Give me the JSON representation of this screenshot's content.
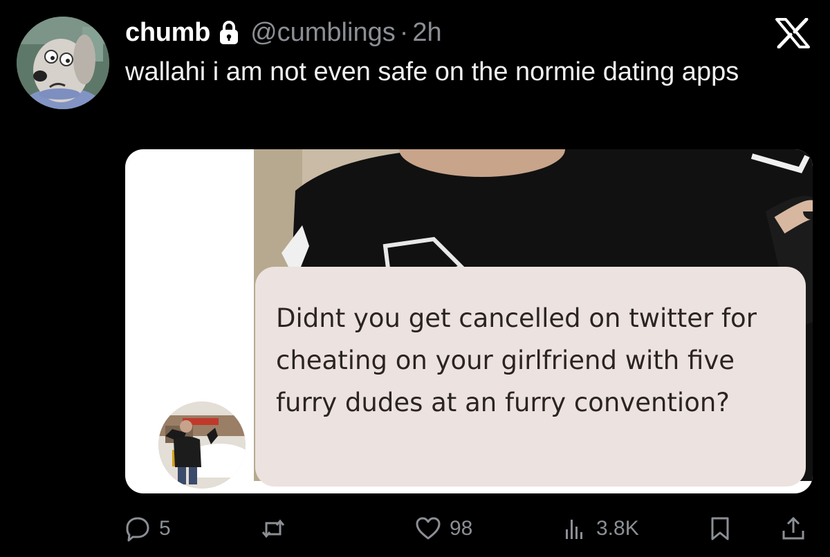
{
  "tweet": {
    "display_name": "chumb",
    "handle": "@cumblings",
    "separator": "·",
    "time": "2h",
    "text": "wallahi i am not even safe on the normie dating apps"
  },
  "icons": {
    "lock": "lock-icon",
    "close": "x-logo-icon",
    "reply": "reply-icon",
    "retweet": "retweet-icon",
    "like": "heart-icon",
    "views": "views-icon",
    "bookmark": "bookmark-icon",
    "share": "share-icon"
  },
  "media": {
    "message_text": "Didnt you get cancelled on twitter for cheating on your girlfriend with five furry dudes at an furry convention?"
  },
  "actions": {
    "replies": "5",
    "retweets": "",
    "likes": "98",
    "views": "3.8K"
  },
  "colors": {
    "background": "#000000",
    "text": "#e7e9ea",
    "muted": "#8b8f94",
    "bubble": "#ece2df"
  }
}
